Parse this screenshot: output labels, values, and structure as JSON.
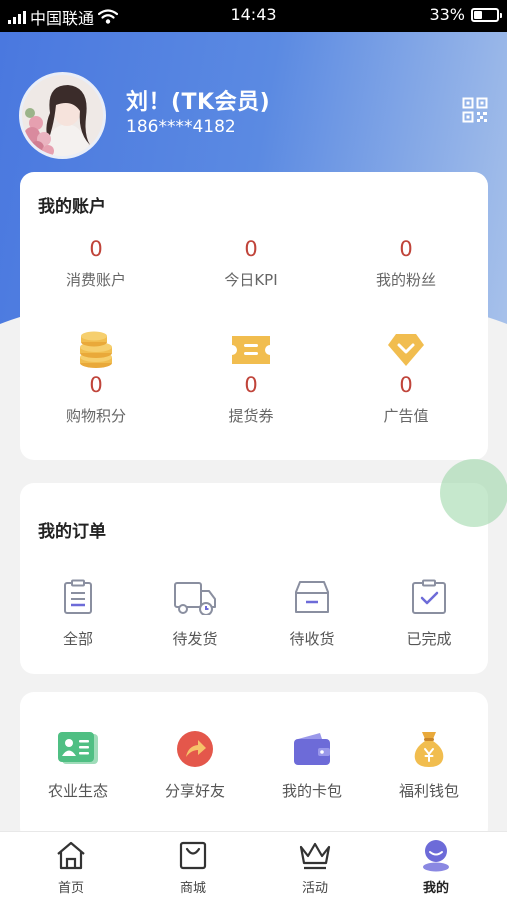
{
  "status_bar": {
    "carrier": "中国联通",
    "time": "14:43",
    "battery": "33%"
  },
  "profile": {
    "name": "刘！(TK会员)",
    "phone": "186****4182"
  },
  "account": {
    "title": "我的账户",
    "stats": [
      {
        "value": "0",
        "label": "消费账户"
      },
      {
        "value": "0",
        "label": "今日KPI"
      },
      {
        "value": "0",
        "label": "我的粉丝"
      },
      {
        "value": "0",
        "label": "购物积分",
        "icon": "coins-icon"
      },
      {
        "value": "0",
        "label": "提货券",
        "icon": "ticket-icon"
      },
      {
        "value": "0",
        "label": "广告值",
        "icon": "diamond-icon"
      }
    ]
  },
  "orders": {
    "title": "我的订单",
    "items": [
      {
        "label": "全部",
        "icon": "clipboard-icon"
      },
      {
        "label": "待发货",
        "icon": "truck-icon"
      },
      {
        "label": "待收货",
        "icon": "inbox-icon"
      },
      {
        "label": "已完成",
        "icon": "check-icon"
      }
    ]
  },
  "services": {
    "items": [
      {
        "label": "农业生态",
        "icon": "id-card-icon"
      },
      {
        "label": "分享好友",
        "icon": "share-icon"
      },
      {
        "label": "我的卡包",
        "icon": "wallet-icon"
      },
      {
        "label": "福利钱包",
        "icon": "money-bag-icon"
      }
    ]
  },
  "tabs": [
    {
      "label": "首页",
      "icon": "home-icon"
    },
    {
      "label": "商城",
      "icon": "shopping-bag-icon"
    },
    {
      "label": "活动",
      "icon": "crown-icon"
    },
    {
      "label": "我的",
      "icon": "user-icon",
      "active": true
    }
  ],
  "colors": {
    "accent_blue": "#4a78df",
    "value_red": "#c0443a",
    "icon_gold": "#f1bd4f",
    "icon_green": "#4fbf83",
    "icon_orange_red": "#e4574b",
    "icon_purple": "#6d6bd8"
  }
}
